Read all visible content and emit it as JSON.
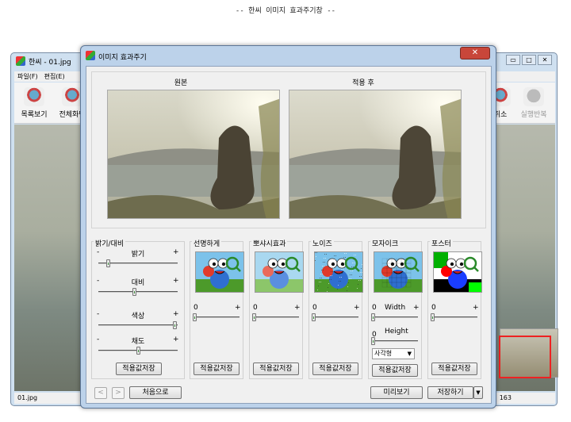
{
  "caption": "-- 한씨 이미지 효과주기창 --",
  "main_window": {
    "title": "한씨 - 01.jpg",
    "menu": [
      "파일(F)",
      "편집(E)"
    ],
    "toolbar": [
      {
        "label": "목록보기",
        "icon": "list-view-icon"
      },
      {
        "label": "전체화면",
        "icon": "fullscreen-icon"
      },
      {
        "label": "취소",
        "icon": "undo-icon"
      },
      {
        "label": "실행반복",
        "icon": "redo-icon"
      }
    ],
    "status_left": "01.jpg",
    "status_right": "163",
    "window_controls": [
      "▭",
      "□",
      "✕"
    ]
  },
  "dialog": {
    "title": "이미지 효과주기",
    "close": "✕",
    "original_label": "원본",
    "applied_label": "적용 후",
    "brightness": {
      "title": "밝기/대비",
      "sliders": [
        {
          "label": "밝기",
          "value": 0.1
        },
        {
          "label": "대비",
          "value": 0.45
        },
        {
          "label": "색상",
          "value": 0.98
        },
        {
          "label": "채도",
          "value": 0.5
        }
      ],
      "minus": "-",
      "plus": "+",
      "save": "적용값저장"
    },
    "effects": [
      {
        "title": "선명하게",
        "value": "0",
        "plus": "+",
        "save": "적용값저장",
        "style": "sharpen"
      },
      {
        "title": "뽀샤시효과",
        "value": "0",
        "plus": "+",
        "save": "적용값저장",
        "style": "soft"
      },
      {
        "title": "노이즈",
        "value": "0",
        "plus": "+",
        "save": "적용값저장",
        "style": "noise"
      },
      {
        "title": "포스터",
        "value": "0",
        "plus": "+",
        "save": "적용값저장",
        "style": "poster"
      }
    ],
    "mosaic": {
      "title": "모자이크",
      "width_label": "Width",
      "width_value": "0",
      "height_label": "Height",
      "height_value": "0",
      "plus": "+",
      "shape": "사각형",
      "save": "적용값저장"
    },
    "footer": {
      "prev": "<",
      "next": ">",
      "reset": "처음으로",
      "preview": "미리보기",
      "save": "저장하기",
      "save_dropdown": "▼"
    }
  }
}
